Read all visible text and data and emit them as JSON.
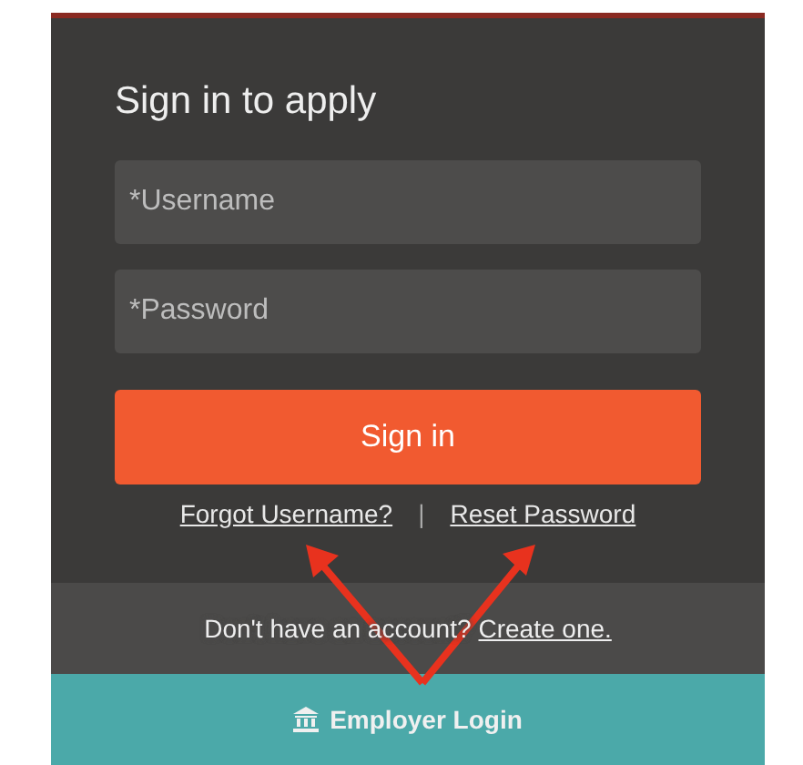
{
  "form": {
    "title": "Sign in to apply",
    "fields": [
      {
        "placeholder": "*Username"
      },
      {
        "placeholder": "*Password"
      }
    ],
    "submit_button": "Sign in",
    "links": [
      "Forgot Username?",
      "Reset Password"
    ],
    "separator": "|"
  },
  "signup_bar": {
    "text": "Don't have an account?",
    "link": "Create one."
  },
  "employer_bar": {
    "label": "Employer Login"
  }
}
